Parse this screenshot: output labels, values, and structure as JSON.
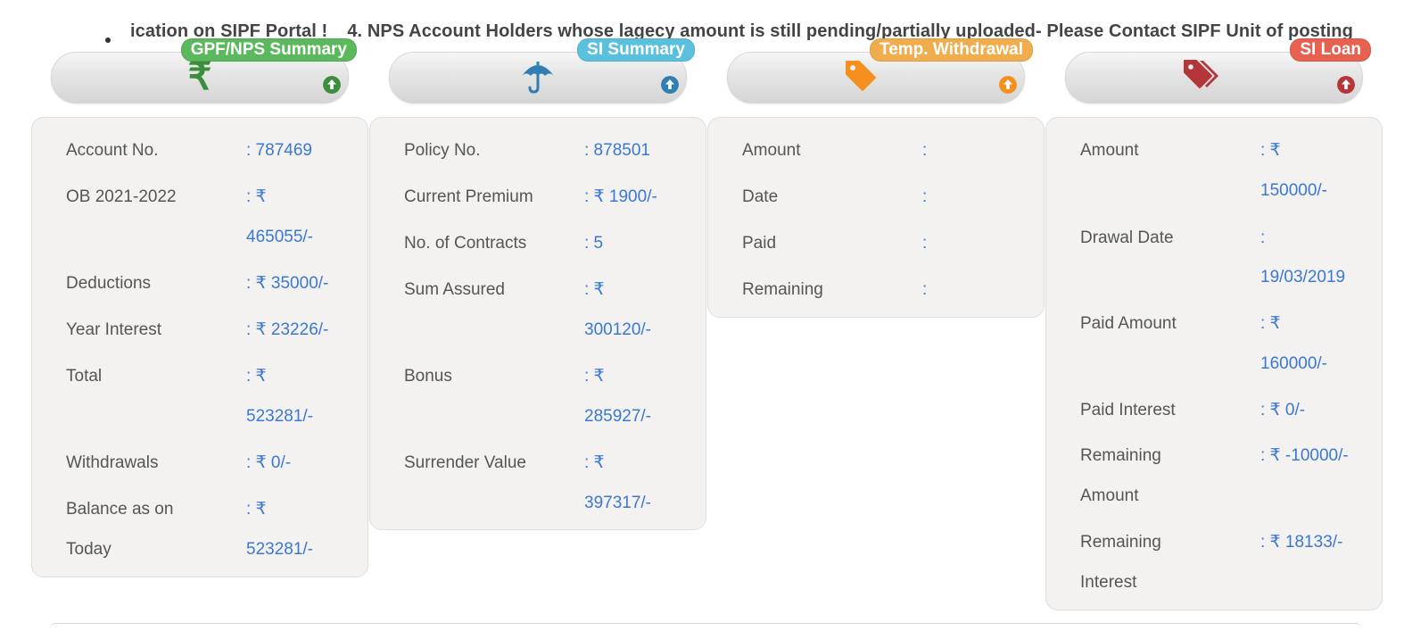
{
  "ticker": {
    "segment_1": "ication on SIPF Portal !",
    "segment_2": "4. NPS Account Holders whose lagecy amount is still pending/partially uploaded- Please Contact SIPF Unit of posting"
  },
  "tiles": [
    {
      "label": "GPF/NPS Summary",
      "icon": "rupee-icon",
      "color": "#5cb85c"
    },
    {
      "label": "SI Summary",
      "icon": "umbrella-icon",
      "color": "#5bc0de"
    },
    {
      "label": "Temp. Withdrawal",
      "icon": "tag-icon",
      "color": "#f0ad4e"
    },
    {
      "label": "SI Loan",
      "icon": "tags-icon",
      "color": "#d9534f"
    }
  ],
  "gpf": {
    "account_no": {
      "label": "Account No.",
      "value": ": 787469"
    },
    "ob": {
      "label": "OB 2021-2022",
      "value_1": ": ₹",
      "value_2": "465055/-"
    },
    "deductions": {
      "label": "Deductions",
      "value": ": ₹ 35000/-"
    },
    "year_interest": {
      "label": "Year Interest",
      "value": ": ₹ 23226/-"
    },
    "total": {
      "label": "Total",
      "value_1": ": ₹",
      "value_2": "523281/-"
    },
    "withdrawals": {
      "label": "Withdrawals",
      "value": ": ₹ 0/-"
    },
    "balance": {
      "label_1": "Balance as on",
      "label_2": "Today",
      "value_1": ": ₹",
      "value_2": "523281/-"
    }
  },
  "si": {
    "policy_no": {
      "label": "Policy No.",
      "value": ": 878501"
    },
    "current_premium": {
      "label": "Current Premium",
      "value": ": ₹ 1900/-"
    },
    "contracts": {
      "label": "No. of Contracts",
      "value": ": 5"
    },
    "sum_assured": {
      "label": "Sum Assured",
      "value_1": ": ₹",
      "value_2": "300120/-"
    },
    "bonus": {
      "label": "Bonus",
      "value_1": ": ₹",
      "value_2": "285927/-"
    },
    "surrender": {
      "label": "Surrender Value",
      "value_1": ": ₹",
      "value_2": "397317/-"
    }
  },
  "tw": {
    "amount": {
      "label": "Amount",
      "value": ":"
    },
    "date": {
      "label": "Date",
      "value": ":"
    },
    "paid": {
      "label": "Paid",
      "value": ":"
    },
    "remaining": {
      "label": "Remaining",
      "value": ":"
    }
  },
  "loan": {
    "amount": {
      "label": "Amount",
      "value_1": ": ₹",
      "value_2": "150000/-"
    },
    "drawal_date": {
      "label": "Drawal Date",
      "value_1": ":",
      "value_2": "19/03/2019"
    },
    "paid_amount": {
      "label": "Paid Amount",
      "value_1": ": ₹",
      "value_2": "160000/-"
    },
    "paid_interest": {
      "label": "Paid Interest",
      "value": ": ₹ 0/-"
    },
    "remaining_amount": {
      "label_1": "Remaining",
      "label_2": "Amount",
      "value": ": ₹ -10000/-"
    },
    "remaining_interest": {
      "label_1": "Remaining",
      "label_2": "Interest",
      "value": ": ₹ 18133/-"
    }
  }
}
